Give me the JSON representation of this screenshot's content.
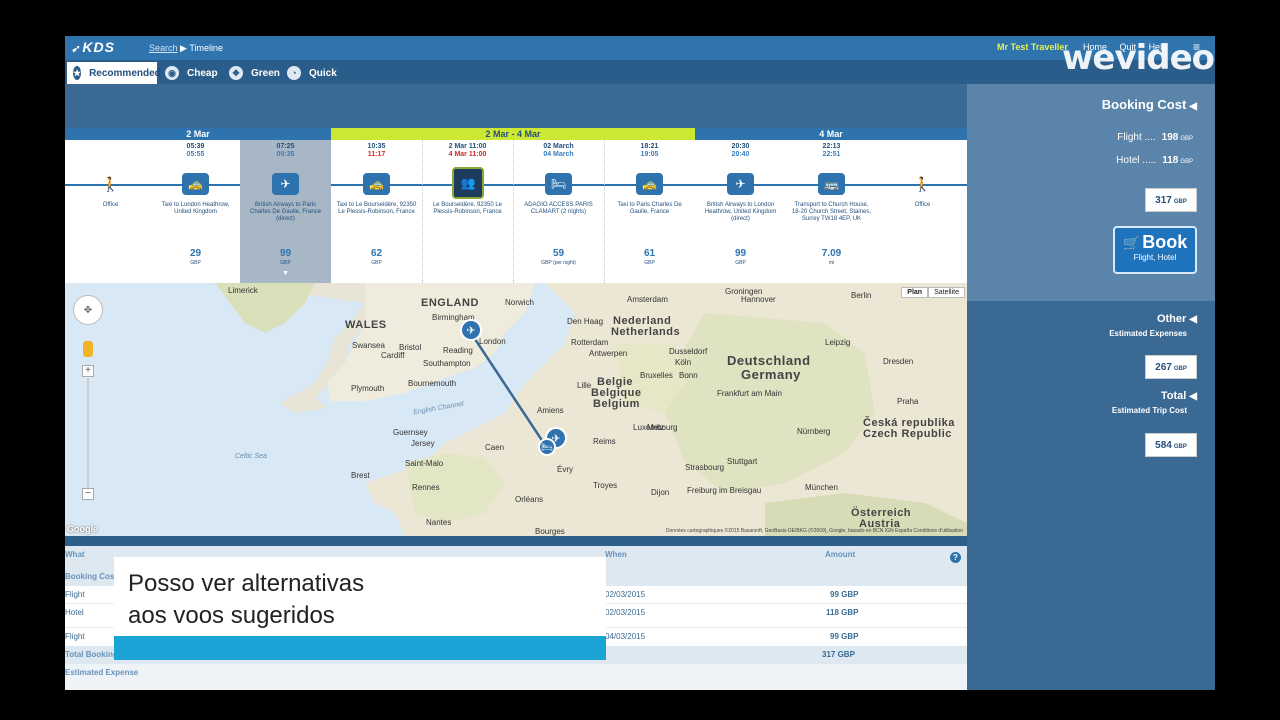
{
  "header": {
    "logo": "KDS",
    "breadcrumb_search": "Search",
    "breadcrumb_sep": "▶",
    "breadcrumb_current": "Timeline",
    "user_name": "Mr Test Traveller",
    "links": [
      "Home",
      "Quit",
      "Help"
    ]
  },
  "modes": [
    {
      "label": "Recommended",
      "icon": "star-icon",
      "glyph": "★"
    },
    {
      "label": "Cheap",
      "icon": "wallet-icon",
      "glyph": "◉"
    },
    {
      "label": "Green",
      "icon": "leaf-icon",
      "glyph": "❖"
    },
    {
      "label": "Quick",
      "icon": "clock-icon",
      "glyph": "◔"
    }
  ],
  "timeline": {
    "days": [
      "2 Mar",
      "2 Mar - 4 Mar",
      "4 Mar"
    ],
    "segments": [
      {
        "t1": "",
        "t2": "",
        "icon": "walking-person-icon",
        "glyph": "🚶",
        "desc": "Office",
        "price": "",
        "unit": ""
      },
      {
        "t1": "05:39",
        "t2": "05:55",
        "icon": "taxi-icon",
        "glyph": "🚕",
        "desc": "Taxi to London Heathrow, United Kingdom",
        "price": "29",
        "unit": "GBP"
      },
      {
        "t1": "07:25",
        "t2": "09:35",
        "icon": "plane-icon",
        "glyph": "✈",
        "desc": "British Airways to Paris Charles De Gaulle, France (direct)",
        "price": "99",
        "unit": "GBP"
      },
      {
        "t1": "10:35",
        "t2": "11:17",
        "icon": "taxi-icon",
        "glyph": "🚕",
        "desc": "Taxi to Le Bourseidère, 92350 Le Plessis-Robinson, France",
        "price": "62",
        "unit": "GBP"
      },
      {
        "t1": "2 Mar 11:00",
        "t2": "4 Mar 11:00",
        "icon": "meeting-icon",
        "glyph": "👥",
        "desc": "Le Bourseidère, 92350 Le Plessis-Robinson, France",
        "price": "",
        "unit": ""
      },
      {
        "t1": "02 March",
        "t2": "04 March",
        "icon": "hotel-bed-icon",
        "glyph": "🛏",
        "desc": "ADAGIO ACCESS PARIS CLAMART (2 nights)",
        "price": "59",
        "unit": "GBP (per night)"
      },
      {
        "t1": "18:21",
        "t2": "19:05",
        "icon": "taxi-icon",
        "glyph": "🚕",
        "desc": "Taxi to Paris Charles De Gaulle, France",
        "price": "61",
        "unit": "GBP"
      },
      {
        "t1": "20:30",
        "t2": "20:40",
        "icon": "plane-icon",
        "glyph": "✈",
        "desc": "British Airways to London Heathrow, United Kingdom (direct)",
        "price": "99",
        "unit": "GBP"
      },
      {
        "t1": "22:13",
        "t2": "22:51",
        "icon": "bus-icon",
        "glyph": "🚌",
        "desc": "Transport to Church House, 18-20 Church Street, Staines, Surrey TW18 4EP, UK",
        "price": "7.09",
        "unit": "mi"
      },
      {
        "t1": "",
        "t2": "",
        "icon": "walking-person-icon",
        "glyph": "🚶",
        "desc": "Office",
        "price": "",
        "unit": ""
      }
    ]
  },
  "map": {
    "type_options": [
      "Plan",
      "Satellite"
    ],
    "labels": {
      "country": [
        "ENGLAND",
        "WALES",
        "Nederland",
        "Netherlands",
        "Belgie",
        "Belgique",
        "Belgium",
        "Deutschland",
        "Germany",
        "Česká republika",
        "Czech Republic",
        "Luxembourg",
        "Österreich",
        "Austria"
      ],
      "cities": [
        "Limerick",
        "Birmingham",
        "Norwich",
        "Cardiff",
        "London",
        "Bristol",
        "Reading",
        "Swansea",
        "Southampton",
        "Plymouth",
        "Bournemouth",
        "Guernsey",
        "Jersey",
        "Saint-Malo",
        "Rennes",
        "Nantes",
        "Brest",
        "Caen",
        "Amiens",
        "Lille",
        "Bruxelles",
        "Den Haag",
        "Amsterdam",
        "Rotterdam",
        "Antwerpen",
        "Dusseldorf",
        "Köln",
        "Bonn",
        "Frankfurt am Main",
        "Nürnberg",
        "Stuttgart",
        "München",
        "Hannover",
        "Berlin",
        "Leipzig",
        "Dresden",
        "Praha",
        "Reims",
        "Metz",
        "Strasbourg",
        "Orléans",
        "Évry",
        "Troyes",
        "Dijon",
        "Freiburg im Breisgau",
        "Bourges",
        "Groningen"
      ],
      "seas": [
        "Celtic Sea",
        "English Channel"
      ]
    },
    "credits": "Données cartographiques ©2015 Basarsoft, GeoBasis-DE/BKG (©2009), Google, basado en BCN IGN España   Conditions d'utilisation",
    "google_label": "Google"
  },
  "table": {
    "headers": [
      "What",
      "Booking Cost",
      "Flight",
      "Hotel",
      "Flight",
      "Total Booking Cost",
      "Estimated Expense"
    ],
    "when_header": "When",
    "amount_header": "Amount",
    "rows": [
      {
        "label": "Flight",
        "date": "02/03/2015",
        "amount": "99 GBP"
      },
      {
        "label": "Hotel",
        "date": "02/03/2015",
        "amount": "118 GBP"
      },
      {
        "label": "Flight",
        "date": "04/03/2015",
        "amount": "99 GBP"
      }
    ],
    "total_label": "Total Booking Cost",
    "total_amount": "317 GBP",
    "estimated_label": "Estimated Expense"
  },
  "caption": {
    "text": "Posso ver alternativas\naos voos sugeridos"
  },
  "sidebar": {
    "booking_title": "Booking Cost",
    "flight_label": "Flight ....",
    "flight_amount": "198",
    "hotel_label": "Hotel .....",
    "hotel_amount": "118",
    "currency": "GBP",
    "booking_total": "317",
    "book_label": "Book",
    "book_sub": "Flight, Hotel",
    "other_title": "Other",
    "other_sub": "Estimated Expenses",
    "other_amount": "267",
    "total_title": "Total",
    "total_sub": "Estimated Trip Cost",
    "total_amount": "584"
  },
  "watermark": "wevideo",
  "colors": {
    "primary": "#2e73ad",
    "accent_green": "#cde832",
    "caption_bar": "#1aa3d4"
  }
}
